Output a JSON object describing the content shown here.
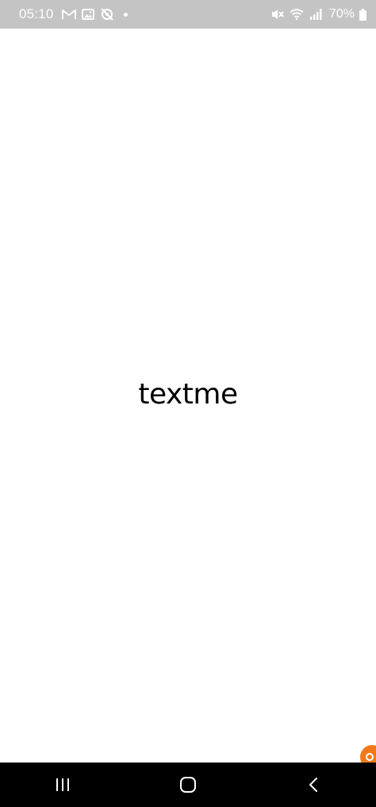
{
  "status_bar": {
    "time": "05:10",
    "battery_percent": "70%",
    "icons_left": [
      "gmail-icon",
      "gallery-icon",
      "location-off-icon"
    ],
    "icons_right": [
      "mute-icon",
      "wifi-icon",
      "signal-icon",
      "battery-icon"
    ]
  },
  "splash": {
    "logo_text": "textme"
  },
  "nav_bar": {
    "buttons": [
      "recent-apps",
      "home",
      "back"
    ]
  },
  "colors": {
    "status_bar_bg": "#c4c4c4",
    "background": "#ffffff",
    "logo_text": "#000000",
    "nav_bar_bg": "#000000",
    "badge": "#f07a1a"
  }
}
